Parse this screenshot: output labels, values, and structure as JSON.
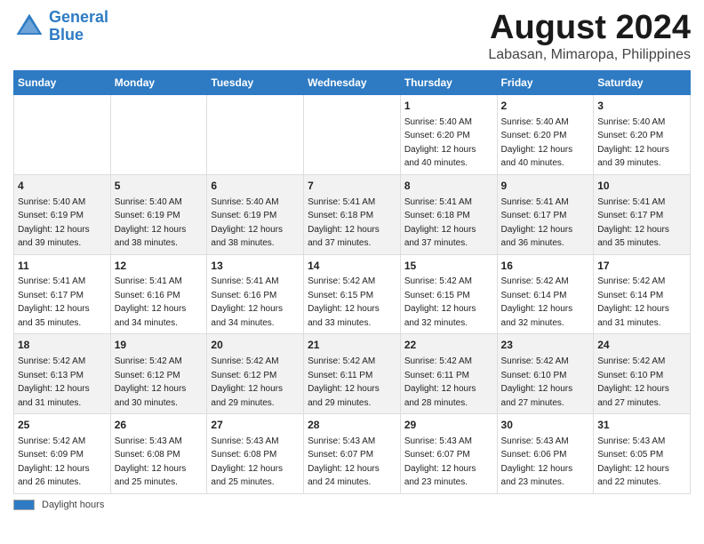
{
  "header": {
    "logo_line1": "General",
    "logo_line2": "Blue",
    "main_title": "August 2024",
    "subtitle": "Labasan, Mimaropa, Philippines"
  },
  "calendar": {
    "days_of_week": [
      "Sunday",
      "Monday",
      "Tuesday",
      "Wednesday",
      "Thursday",
      "Friday",
      "Saturday"
    ],
    "weeks": [
      [
        {
          "day": "",
          "info": ""
        },
        {
          "day": "",
          "info": ""
        },
        {
          "day": "",
          "info": ""
        },
        {
          "day": "",
          "info": ""
        },
        {
          "day": "1",
          "info": "Sunrise: 5:40 AM\nSunset: 6:20 PM\nDaylight: 12 hours\nand 40 minutes."
        },
        {
          "day": "2",
          "info": "Sunrise: 5:40 AM\nSunset: 6:20 PM\nDaylight: 12 hours\nand 40 minutes."
        },
        {
          "day": "3",
          "info": "Sunrise: 5:40 AM\nSunset: 6:20 PM\nDaylight: 12 hours\nand 39 minutes."
        }
      ],
      [
        {
          "day": "4",
          "info": "Sunrise: 5:40 AM\nSunset: 6:19 PM\nDaylight: 12 hours\nand 39 minutes."
        },
        {
          "day": "5",
          "info": "Sunrise: 5:40 AM\nSunset: 6:19 PM\nDaylight: 12 hours\nand 38 minutes."
        },
        {
          "day": "6",
          "info": "Sunrise: 5:40 AM\nSunset: 6:19 PM\nDaylight: 12 hours\nand 38 minutes."
        },
        {
          "day": "7",
          "info": "Sunrise: 5:41 AM\nSunset: 6:18 PM\nDaylight: 12 hours\nand 37 minutes."
        },
        {
          "day": "8",
          "info": "Sunrise: 5:41 AM\nSunset: 6:18 PM\nDaylight: 12 hours\nand 37 minutes."
        },
        {
          "day": "9",
          "info": "Sunrise: 5:41 AM\nSunset: 6:17 PM\nDaylight: 12 hours\nand 36 minutes."
        },
        {
          "day": "10",
          "info": "Sunrise: 5:41 AM\nSunset: 6:17 PM\nDaylight: 12 hours\nand 35 minutes."
        }
      ],
      [
        {
          "day": "11",
          "info": "Sunrise: 5:41 AM\nSunset: 6:17 PM\nDaylight: 12 hours\nand 35 minutes."
        },
        {
          "day": "12",
          "info": "Sunrise: 5:41 AM\nSunset: 6:16 PM\nDaylight: 12 hours\nand 34 minutes."
        },
        {
          "day": "13",
          "info": "Sunrise: 5:41 AM\nSunset: 6:16 PM\nDaylight: 12 hours\nand 34 minutes."
        },
        {
          "day": "14",
          "info": "Sunrise: 5:42 AM\nSunset: 6:15 PM\nDaylight: 12 hours\nand 33 minutes."
        },
        {
          "day": "15",
          "info": "Sunrise: 5:42 AM\nSunset: 6:15 PM\nDaylight: 12 hours\nand 32 minutes."
        },
        {
          "day": "16",
          "info": "Sunrise: 5:42 AM\nSunset: 6:14 PM\nDaylight: 12 hours\nand 32 minutes."
        },
        {
          "day": "17",
          "info": "Sunrise: 5:42 AM\nSunset: 6:14 PM\nDaylight: 12 hours\nand 31 minutes."
        }
      ],
      [
        {
          "day": "18",
          "info": "Sunrise: 5:42 AM\nSunset: 6:13 PM\nDaylight: 12 hours\nand 31 minutes."
        },
        {
          "day": "19",
          "info": "Sunrise: 5:42 AM\nSunset: 6:12 PM\nDaylight: 12 hours\nand 30 minutes."
        },
        {
          "day": "20",
          "info": "Sunrise: 5:42 AM\nSunset: 6:12 PM\nDaylight: 12 hours\nand 29 minutes."
        },
        {
          "day": "21",
          "info": "Sunrise: 5:42 AM\nSunset: 6:11 PM\nDaylight: 12 hours\nand 29 minutes."
        },
        {
          "day": "22",
          "info": "Sunrise: 5:42 AM\nSunset: 6:11 PM\nDaylight: 12 hours\nand 28 minutes."
        },
        {
          "day": "23",
          "info": "Sunrise: 5:42 AM\nSunset: 6:10 PM\nDaylight: 12 hours\nand 27 minutes."
        },
        {
          "day": "24",
          "info": "Sunrise: 5:42 AM\nSunset: 6:10 PM\nDaylight: 12 hours\nand 27 minutes."
        }
      ],
      [
        {
          "day": "25",
          "info": "Sunrise: 5:42 AM\nSunset: 6:09 PM\nDaylight: 12 hours\nand 26 minutes."
        },
        {
          "day": "26",
          "info": "Sunrise: 5:43 AM\nSunset: 6:08 PM\nDaylight: 12 hours\nand 25 minutes."
        },
        {
          "day": "27",
          "info": "Sunrise: 5:43 AM\nSunset: 6:08 PM\nDaylight: 12 hours\nand 25 minutes."
        },
        {
          "day": "28",
          "info": "Sunrise: 5:43 AM\nSunset: 6:07 PM\nDaylight: 12 hours\nand 24 minutes."
        },
        {
          "day": "29",
          "info": "Sunrise: 5:43 AM\nSunset: 6:07 PM\nDaylight: 12 hours\nand 23 minutes."
        },
        {
          "day": "30",
          "info": "Sunrise: 5:43 AM\nSunset: 6:06 PM\nDaylight: 12 hours\nand 23 minutes."
        },
        {
          "day": "31",
          "info": "Sunrise: 5:43 AM\nSunset: 6:05 PM\nDaylight: 12 hours\nand 22 minutes."
        }
      ]
    ]
  },
  "footer": {
    "daylight_label": "Daylight hours"
  }
}
